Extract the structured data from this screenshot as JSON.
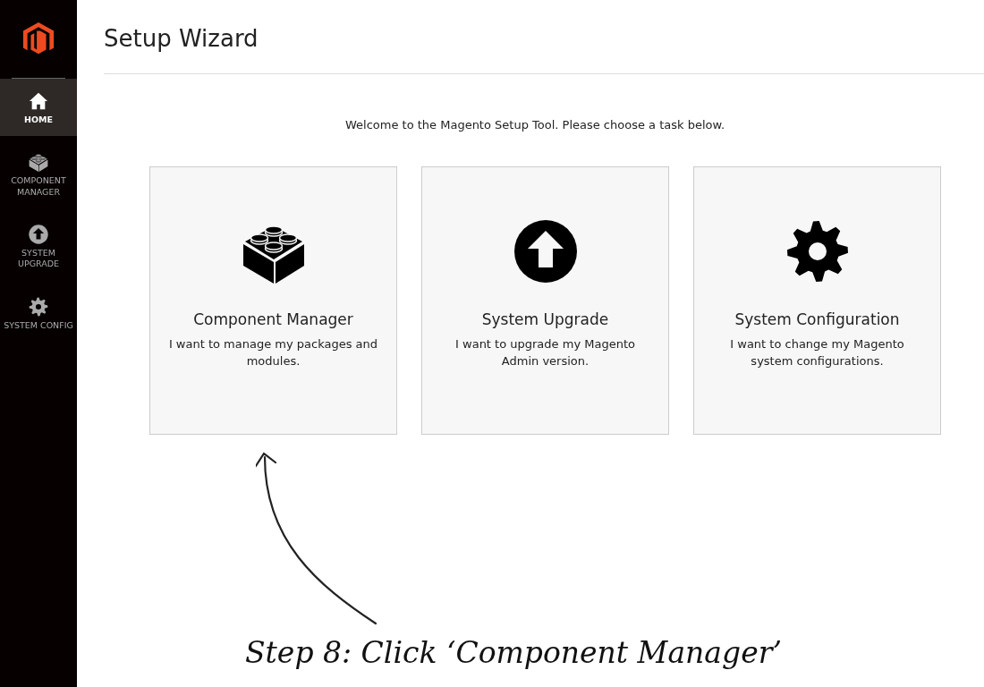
{
  "sidebar": {
    "items": [
      {
        "label": "HOME",
        "kind": "home",
        "selected": true
      },
      {
        "label": "COMPONENT MANAGER",
        "kind": "block",
        "selected": false
      },
      {
        "label": "SYSTEM UPGRADE",
        "kind": "upgrade",
        "selected": false
      },
      {
        "label": "SYSTEM CONFIG",
        "kind": "gear",
        "selected": false
      }
    ]
  },
  "page": {
    "title": "Setup Wizard",
    "intro": "Welcome to the Magento Setup Tool. Please choose a task below."
  },
  "tasks": [
    {
      "title": "Component Manager",
      "description": "I want to manage my packages and modules.",
      "kind": "block"
    },
    {
      "title": "System Upgrade",
      "description": "I want to upgrade my Magento Admin version.",
      "kind": "upgrade"
    },
    {
      "title": "System Configuration",
      "description": "I want to change my Magento system configurations.",
      "kind": "gear"
    }
  ],
  "annotation": {
    "text": "Step 8: Click ‘Component Manager’"
  }
}
